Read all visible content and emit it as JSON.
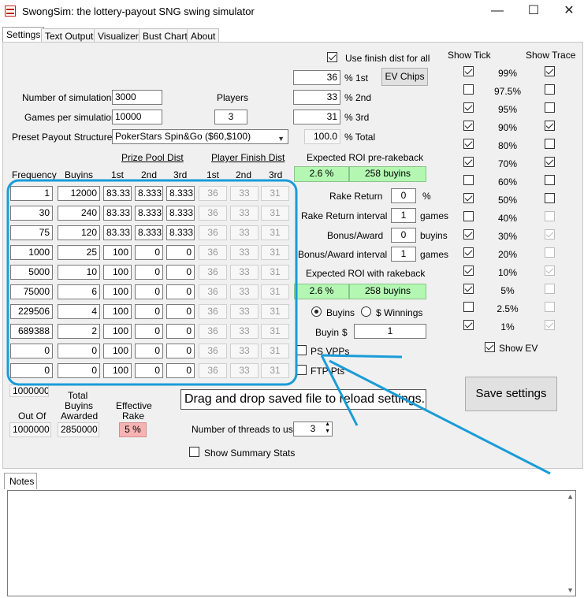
{
  "window": {
    "title": "SwongSim: the lottery-payout SNG swing simulator",
    "minimize": "—",
    "maximize": "☐",
    "close": "✕"
  },
  "tabs": [
    "Settings",
    "Text Output",
    "Visualizer",
    "Bust Chart",
    "About"
  ],
  "left": {
    "num_sims_label": "Number of simulations",
    "num_sims_value": "3000",
    "games_label": "Games per simulation",
    "games_value": "10000",
    "preset_label": "Preset Payout Structures",
    "preset_value": "PokerStars Spin&Go ($60,$100)",
    "players_label": "Players",
    "players_value": "3"
  },
  "finish": {
    "use_label": "Use finish dist for all",
    "use_checked": true,
    "pct1_value": "36",
    "pct1_label": "% 1st",
    "pct2_value": "33",
    "pct2_label": "% 2nd",
    "pct3_value": "31",
    "pct3_label": "% 3rd",
    "total_value": "100.0",
    "total_label": "% Total",
    "ev_chips": "EV Chips"
  },
  "table": {
    "prize_pool_header": "Prize Pool Dist",
    "player_finish_header": "Player Finish Dist",
    "col_frequency": "Frequency",
    "col_buyins": "Buyins",
    "col_1st": "1st",
    "col_2nd": "2nd",
    "col_3rd": "3rd",
    "col_p1st": "1st",
    "col_p2nd": "2nd",
    "col_p3rd": "3rd",
    "rows": [
      [
        "1",
        "12000",
        "83.33",
        "8.333",
        "8.333",
        "36",
        "33",
        "31"
      ],
      [
        "30",
        "240",
        "83.33",
        "8.333",
        "8.333",
        "36",
        "33",
        "31"
      ],
      [
        "75",
        "120",
        "83.33",
        "8.333",
        "8.333",
        "36",
        "33",
        "31"
      ],
      [
        "1000",
        "25",
        "100",
        "0",
        "0",
        "36",
        "33",
        "31"
      ],
      [
        "5000",
        "10",
        "100",
        "0",
        "0",
        "36",
        "33",
        "31"
      ],
      [
        "75000",
        "6",
        "100",
        "0",
        "0",
        "36",
        "33",
        "31"
      ],
      [
        "229506",
        "4",
        "100",
        "0",
        "0",
        "36",
        "33",
        "31"
      ],
      [
        "689388",
        "2",
        "100",
        "0",
        "0",
        "36",
        "33",
        "31"
      ],
      [
        "0",
        "0",
        "100",
        "0",
        "0",
        "36",
        "33",
        "31"
      ],
      [
        "0",
        "0",
        "100",
        "0",
        "0",
        "36",
        "33",
        "31"
      ]
    ],
    "freq_sum": "1000000",
    "out_of_label": "Out Of",
    "out_of_value": "1000000",
    "total_buyins_label_1": "Total",
    "total_buyins_label_2": "Buyins",
    "total_buyins_label_3": "Awarded",
    "total_buyins_value": "2850000",
    "eff_rake_label_1": "Effective",
    "eff_rake_label_2": "Rake",
    "eff_rake_value": "5 %"
  },
  "roi": {
    "pre_label": "Expected ROI pre-rakeback",
    "pre_pct": "2.6 %",
    "pre_buyins": "258 buyins",
    "rake_return_label": "Rake Return",
    "rake_return_value": "0",
    "rake_return_unit": "%",
    "rake_interval_label": "Rake Return interval",
    "rake_interval_value": "1",
    "rake_interval_unit": "games",
    "bonus_label": "Bonus/Award",
    "bonus_value": "0",
    "bonus_unit": "buyins",
    "bonus_interval_label": "Bonus/Award interval",
    "bonus_interval_value": "1",
    "bonus_interval_unit": "games",
    "with_label": "Expected ROI with rakeback",
    "with_pct": "2.6 %",
    "with_buyins": "258 buyins",
    "radio_buyins": "Buyins",
    "radio_winnings": "$ Winnings",
    "buyin_label": "Buyin",
    "buyin_dollar": "$",
    "buyin_value": "1",
    "ps_vpps": "PS VPPs",
    "ftp_pts": "FTP Pts"
  },
  "bottom": {
    "drag_drop": "Drag and drop saved file to reload settings.",
    "threads_label": "Number of threads to use",
    "threads_value": "3",
    "summary_label": "Show Summary Stats",
    "save_button": "Save settings"
  },
  "ticks": {
    "show_tick_header": "Show Tick",
    "show_trace_header": "Show Trace",
    "rows": [
      {
        "label": "99%",
        "tick": true,
        "trace": true,
        "trace_enabled": true
      },
      {
        "label": "97.5%",
        "tick": false,
        "trace": false,
        "trace_enabled": true
      },
      {
        "label": "95%",
        "tick": true,
        "trace": false,
        "trace_enabled": true
      },
      {
        "label": "90%",
        "tick": true,
        "trace": true,
        "trace_enabled": true
      },
      {
        "label": "80%",
        "tick": true,
        "trace": false,
        "trace_enabled": true
      },
      {
        "label": "70%",
        "tick": true,
        "trace": true,
        "trace_enabled": true
      },
      {
        "label": "60%",
        "tick": false,
        "trace": false,
        "trace_enabled": true
      },
      {
        "label": "50%",
        "tick": true,
        "trace": false,
        "trace_enabled": true
      },
      {
        "label": "40%",
        "tick": false,
        "trace": false,
        "trace_enabled": false
      },
      {
        "label": "30%",
        "tick": true,
        "trace": true,
        "trace_enabled": false
      },
      {
        "label": "20%",
        "tick": true,
        "trace": false,
        "trace_enabled": false
      },
      {
        "label": "10%",
        "tick": true,
        "trace": true,
        "trace_enabled": false
      },
      {
        "label": "5%",
        "tick": true,
        "trace": false,
        "trace_enabled": false
      },
      {
        "label": "2.5%",
        "tick": false,
        "trace": false,
        "trace_enabled": false
      },
      {
        "label": "1%",
        "tick": true,
        "trace": true,
        "trace_enabled": false
      }
    ],
    "show_ev_label": "Show EV",
    "show_ev_checked": true
  },
  "notes": {
    "tab_label": "Notes"
  },
  "colors": {
    "annotation": "#1a9cd8",
    "roi_green": "#b3f7b3",
    "rake_pink": "#f7b3b3"
  }
}
